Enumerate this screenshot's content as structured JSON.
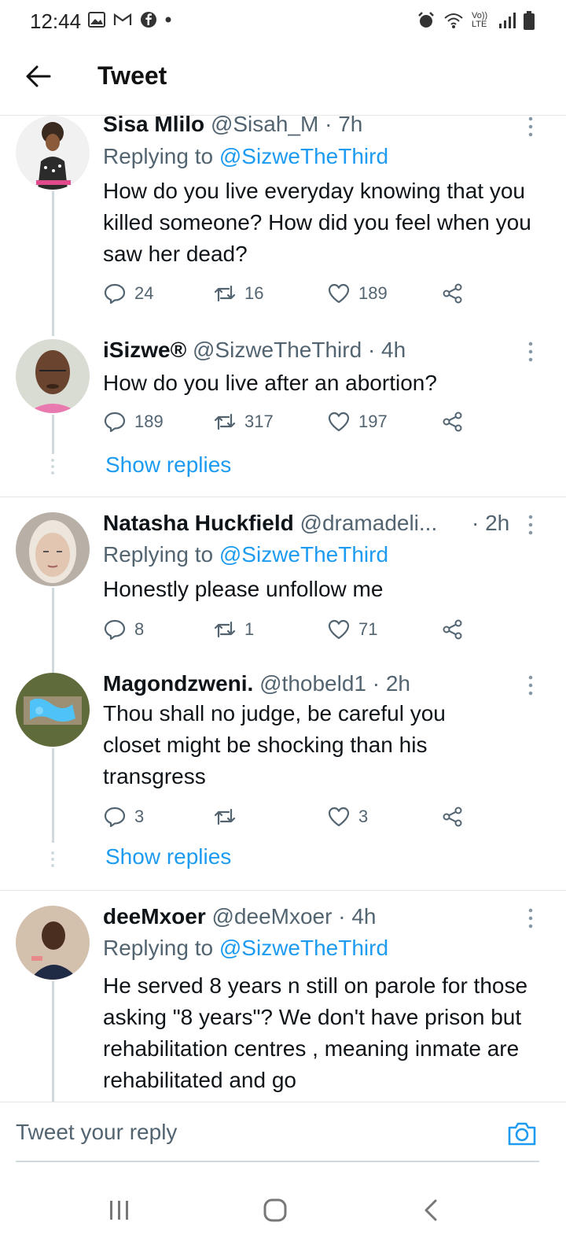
{
  "status_bar": {
    "time": "12:44",
    "icons_left": [
      "gallery-icon",
      "gmail-icon",
      "facebook-icon",
      "dot-icon"
    ],
    "icons_right": [
      "alarm-icon",
      "wifi-icon",
      "volte-icon",
      "signal-icon",
      "battery-icon"
    ],
    "volte_label": "Vo)) LTE"
  },
  "header": {
    "title": "Tweet"
  },
  "tweets": [
    {
      "name": "Sisa Mlilo",
      "handle": "@Sisah_M",
      "time": "· 7h",
      "replying_prefix": "Replying to ",
      "replying_to": "@SizweTheThird",
      "text": "How do you live everyday knowing that you killed someone? How did you feel when you saw her dead?",
      "replies": "24",
      "retweets": "16",
      "likes": "189"
    },
    {
      "name": "iSizwe®",
      "handle": "@SizweTheThird",
      "time": "· 4h",
      "text": "How do you live after an abortion?",
      "replies": "189",
      "retweets": "317",
      "likes": "197",
      "show_replies": "Show replies"
    },
    {
      "name": "Natasha Huckfield",
      "handle": "@dramadeli...",
      "time": "· 2h",
      "replying_prefix": "Replying to ",
      "replying_to": "@SizweTheThird",
      "text": "Honestly please unfollow me",
      "replies": "8",
      "retweets": "1",
      "likes": "71"
    },
    {
      "name": "Magondzweni.",
      "handle": "@thobeld1",
      "time": "· 2h",
      "text": "Thou shall no judge, be careful you closet might be shocking than his transgress",
      "replies": "3",
      "retweets": "",
      "likes": "3",
      "show_replies": "Show replies"
    },
    {
      "name": "deeMxoer",
      "handle": "@deeMxoer",
      "time": "· 4h",
      "replying_prefix": "Replying to ",
      "replying_to": "@SizweTheThird",
      "text": "He served 8 years n still on parole for those asking \"8 years\"? We don't have prison but rehabilitation centres , meaning inmate are rehabilitated and go"
    }
  ],
  "reply_box": {
    "placeholder": "Tweet your reply"
  },
  "colors": {
    "accent": "#1d9bf0",
    "muted": "#536471",
    "text": "#0f1419"
  }
}
